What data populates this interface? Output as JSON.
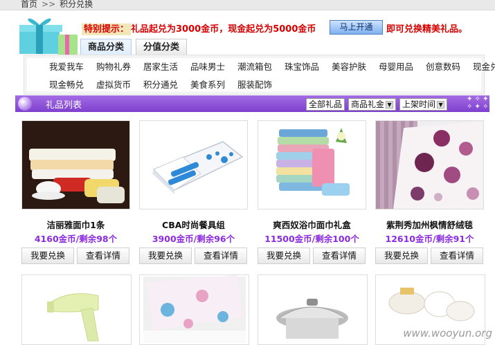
{
  "breadcrumb": {
    "home": "首页",
    "sep": ">>",
    "current": "积分兑换"
  },
  "notice": {
    "label": "特别提示：",
    "text": "礼品起兑为3000金币，现金起兑为5000金币",
    "button": "马上开通",
    "tail": "即可兑换精美礼品。"
  },
  "tabs": [
    {
      "label": "商品分类"
    },
    {
      "label": "分值分类"
    }
  ],
  "categories": {
    "row1": [
      "我爱我车",
      "购物礼券",
      "居家生活",
      "品味男士",
      "潮流箱包",
      "珠宝饰品",
      "美容护肤",
      "母婴用品",
      "创意数码",
      "现金兑换"
    ],
    "row2": [
      "现金畅兑",
      "虚拟货币",
      "积分通兑",
      "美食系列",
      "服装配饰"
    ]
  },
  "gift_bar": {
    "title": "礼品列表",
    "all": "全部礼品",
    "type": "商品礼金",
    "sort": "上架时间"
  },
  "products": [
    {
      "name": "洁丽雅面巾1条",
      "price": "4160金币/剩余98个",
      "exchange": "我要兑换",
      "detail": "查看详情"
    },
    {
      "name": "CBA时尚餐具组",
      "price": "3900金币/剩余96个",
      "exchange": "我要兑换",
      "detail": "查看详情"
    },
    {
      "name": "爽西奴浴巾面巾礼盒",
      "price": "11500金币/剩余100个",
      "exchange": "我要兑换",
      "detail": "查看详情"
    },
    {
      "name": "紫荆秀加州枫情舒绒毯",
      "price": "12610金币/剩余91个",
      "exchange": "我要兑换",
      "detail": "查看详情"
    }
  ],
  "watermark": "www.wooyun.org",
  "colors": {
    "accent_purple": "#8a2be2",
    "notice_red": "#d60000",
    "bar_purple": "#8f52da"
  }
}
